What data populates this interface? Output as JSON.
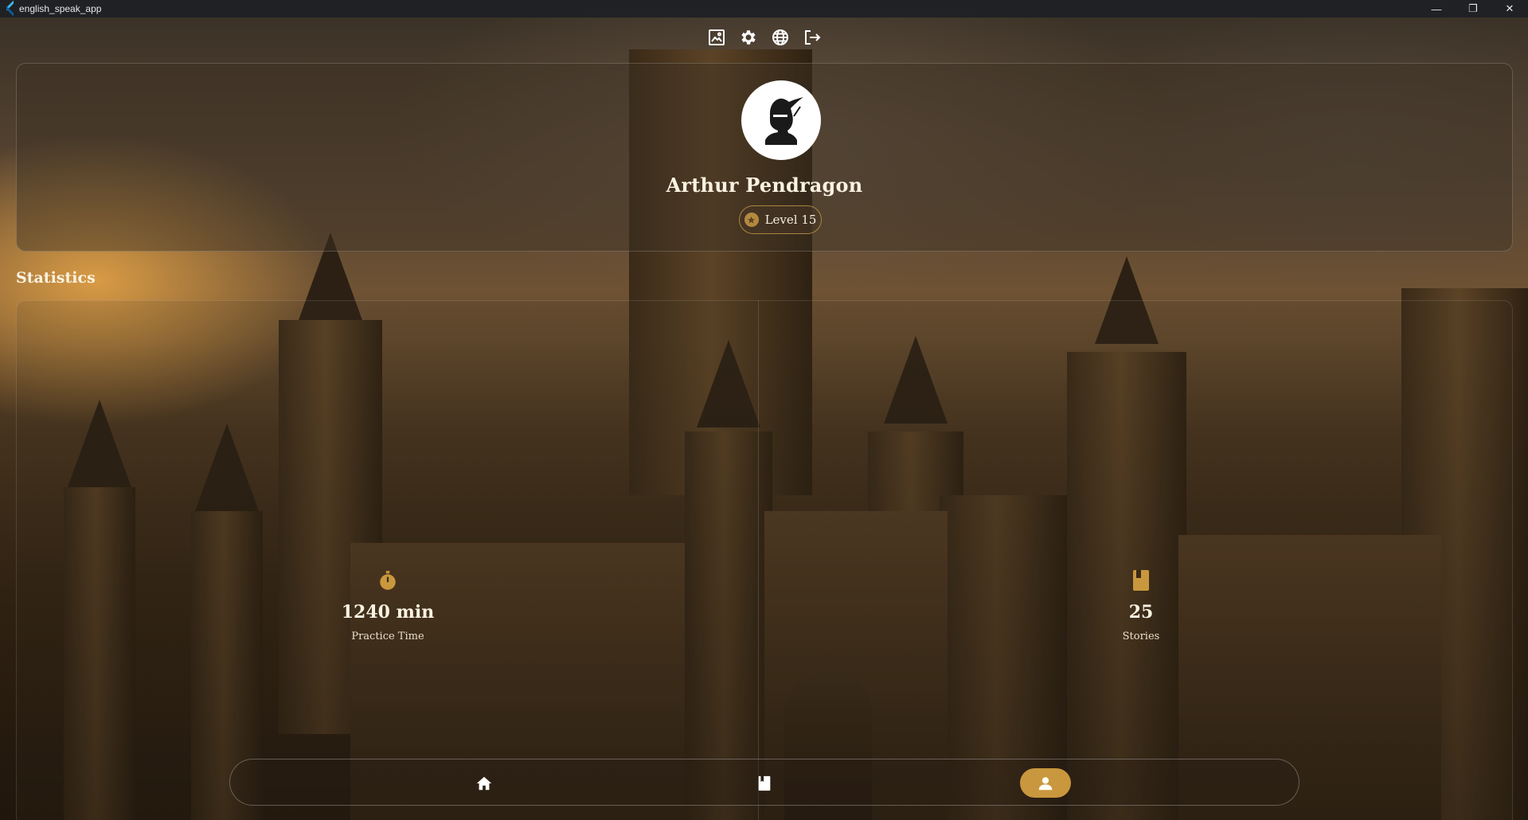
{
  "window": {
    "title": "english_speak_app",
    "controls": [
      "minimize",
      "maximize",
      "close"
    ]
  },
  "toolbar": {
    "icons": [
      "image-icon",
      "gear-icon",
      "globe-icon",
      "logout-icon"
    ]
  },
  "profile": {
    "name": "Arthur Pendragon",
    "level_label": "Level 15",
    "avatar": "knight-avatar"
  },
  "statistics": {
    "title": "Statistics",
    "items": [
      {
        "icon": "timer-icon",
        "value": "1240 min",
        "label": "Practice Time"
      },
      {
        "icon": "book-icon",
        "value": "25",
        "label": "Stories"
      }
    ]
  },
  "bottom_nav": {
    "items": [
      {
        "icon": "home-icon",
        "active": false
      },
      {
        "icon": "book-icon",
        "active": false
      },
      {
        "icon": "person-icon",
        "active": true
      }
    ]
  },
  "colors": {
    "accent": "#c9973d",
    "titlebar": "#202124",
    "text": "#fbf3e2"
  }
}
